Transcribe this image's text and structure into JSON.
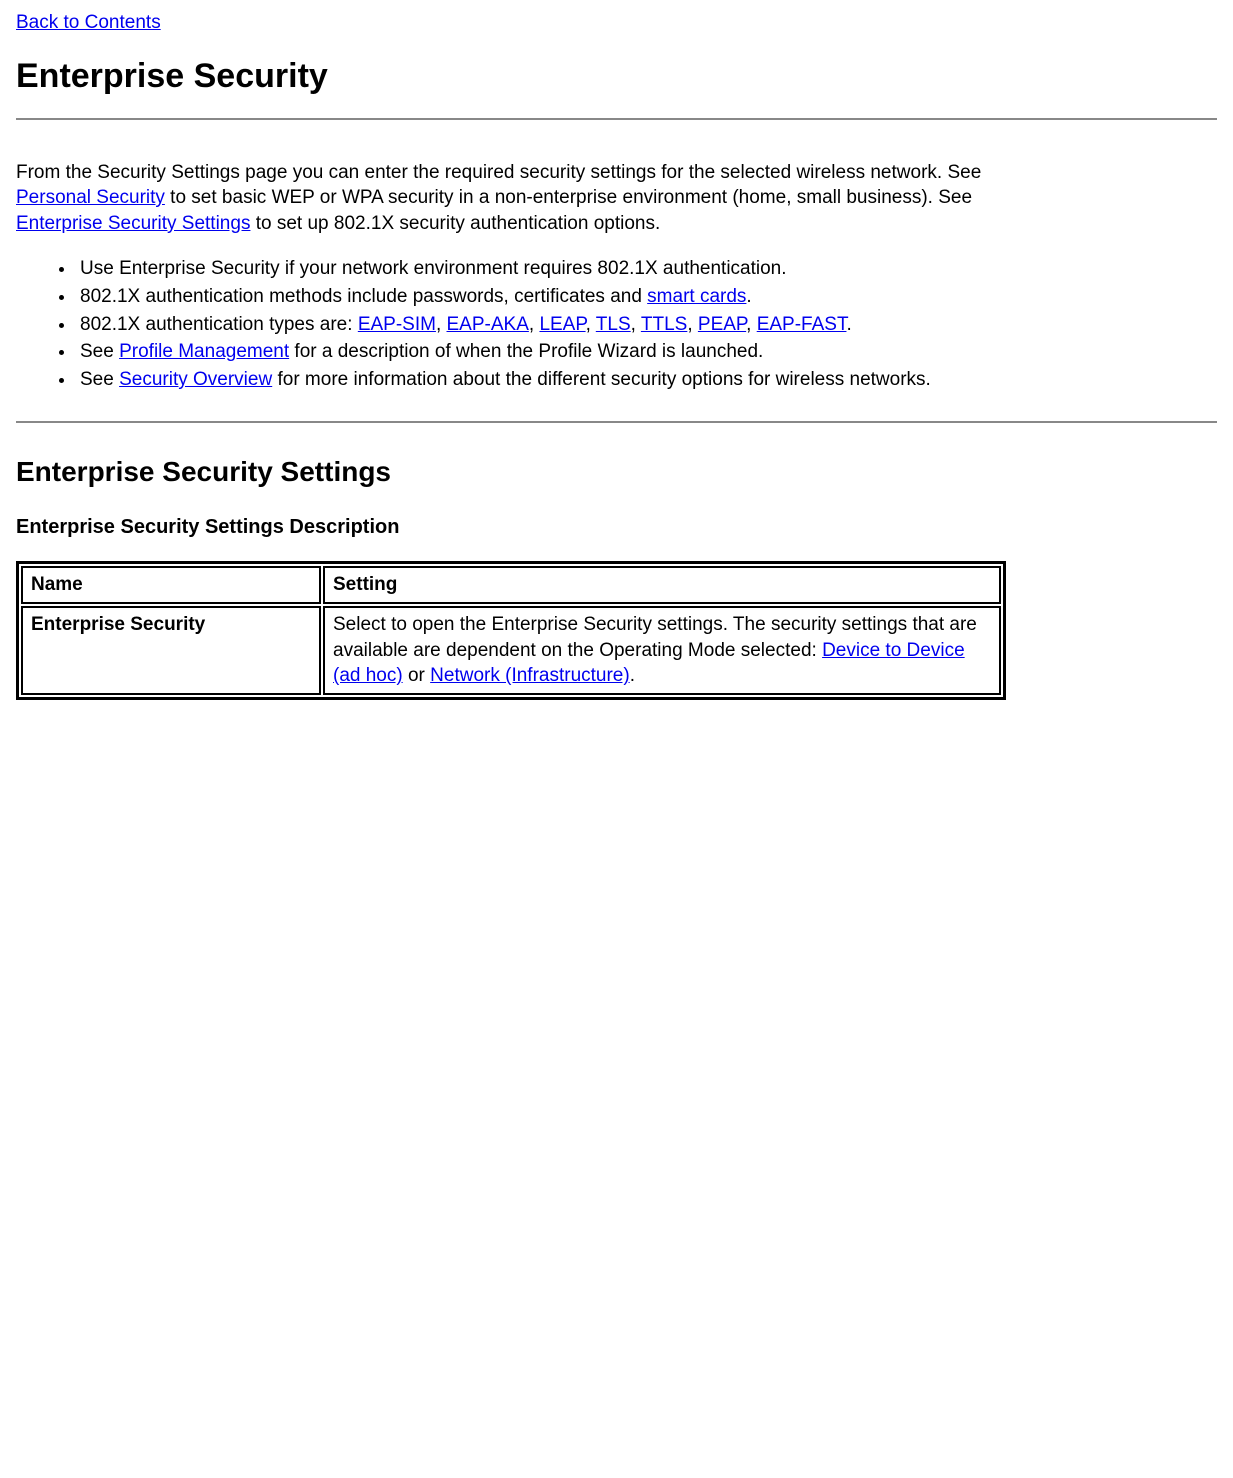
{
  "nav": {
    "back_link": "Back to Contents"
  },
  "heading": "Enterprise Security",
  "intro": {
    "part1": "From the Security Settings page you can enter the required security settings for the selected wireless network. See ",
    "link_personal": "Personal Security",
    "part2": " to set basic WEP or WPA security in a non-enterprise environment (home, small business). See ",
    "link_enterprise": "Enterprise Security Settings",
    "part3": " to set up 802.1X security authentication options."
  },
  "bullets": {
    "b1": "Use Enterprise Security if your network environment requires 802.1X authentication.",
    "b2_pre": "802.1X authentication methods include passwords, certificates and ",
    "b2_link": "smart cards",
    "b2_post": ".",
    "b3_pre": "802.1X authentication types are: ",
    "b3_l1": "EAP-SIM",
    "b3_l2": "EAP-AKA",
    "b3_l3": "LEAP",
    "b3_l4": "TLS",
    "b3_l5": "TTLS",
    "b3_l6": "PEAP",
    "b3_l7": "EAP-FAST",
    "b3_sep": ", ",
    "b3_post": ".",
    "b4_pre": "See ",
    "b4_link": "Profile Management",
    "b4_post": " for a description of when the Profile Wizard is launched.",
    "b5_pre": "See ",
    "b5_link": "Security Overview",
    "b5_post": " for more information about the different security options for wireless networks."
  },
  "section2": {
    "heading": "Enterprise Security Settings",
    "subheading": "Enterprise Security Settings Description"
  },
  "table": {
    "header_name": "Name",
    "header_setting": "Setting",
    "row1": {
      "name": "Enterprise Security",
      "setting_pre": "Select to open the Enterprise Security settings. The security settings that are available are dependent on the Operating Mode selected: ",
      "link1": "Device to Device (ad hoc)",
      "setting_mid": " or ",
      "link2": "Network (Infrastructure)",
      "setting_post": "."
    }
  }
}
